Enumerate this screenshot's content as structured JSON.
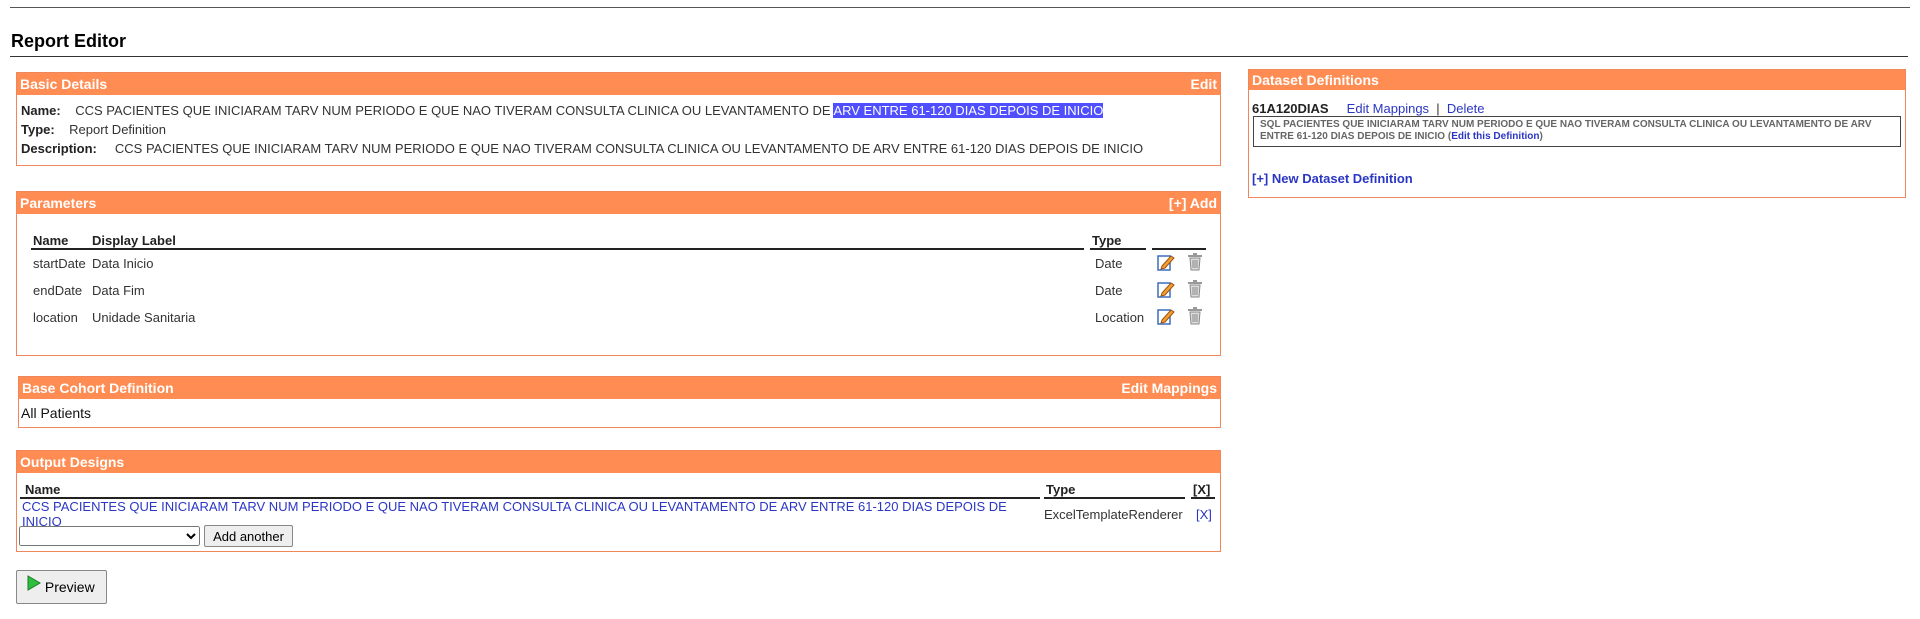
{
  "page": {
    "title": "Report Editor"
  },
  "basic": {
    "header": "Basic Details",
    "edit": "Edit",
    "name_label": "Name:",
    "name_pre": "CCS PACIENTES QUE INICIARAM TARV NUM PERIODO E QUE NAO TIVERAM CONSULTA CLINICA OU LEVANTAMENTO DE ",
    "name_sel": "ARV ENTRE 61-120 DIAS DEPOIS DE INICIO",
    "type_label": "Type:",
    "type_value": "Report Definition",
    "desc_label": "Description:",
    "desc_value": "CCS PACIENTES QUE INICIARAM TARV NUM PERIODO E QUE NAO TIVERAM CONSULTA CLINICA OU LEVANTAMENTO DE ARV ENTRE 61-120 DIAS DEPOIS DE INICIO"
  },
  "params": {
    "header": "Parameters",
    "add": "[+] Add",
    "columns": [
      "Name",
      "Display Label",
      "Type"
    ],
    "rows": [
      {
        "name": "startDate",
        "label": "Data Inicio",
        "type": "Date"
      },
      {
        "name": "endDate",
        "label": "Data Fim",
        "type": "Date"
      },
      {
        "name": "location",
        "label": "Unidade Sanitaria",
        "type": "Location"
      }
    ]
  },
  "cohort": {
    "header": "Base Cohort Definition",
    "edit": "Edit Mappings",
    "value": "All Patients"
  },
  "output": {
    "header": "Output Designs",
    "columns": [
      "Name",
      "Type",
      "[X]"
    ],
    "row": {
      "name": "CCS PACIENTES QUE INICIARAM TARV NUM PERIODO E QUE NAO TIVERAM CONSULTA CLINICA OU LEVANTAMENTO DE ARV ENTRE 61-120 DIAS DEPOIS DE INICIO",
      "type": "ExcelTemplateRenderer",
      "remove": "[X]"
    },
    "select_value": "",
    "add_another": "Add another"
  },
  "preview": "Preview",
  "dataset": {
    "header": "Dataset Definitions",
    "name": "61A120DIAS",
    "edit_mappings": "Edit Mappings",
    "separator": "|",
    "delete": "Delete",
    "sql": "SQL PACIENTES QUE INICIARAM TARV NUM PERIODO E QUE NAO TIVERAM CONSULTA CLINICA OU LEVANTAMENTO DE ARV ENTRE 61-120 DIAS DEPOIS DE INICIO",
    "paren_open": "(",
    "edit_def": "Edit this Definition",
    "paren_close": ")",
    "new_def": "[+] New Dataset Definition"
  },
  "colors": {
    "header_bg": "#ff8c52",
    "border": "#f0875a",
    "link": "#2a36c4",
    "selection": "#4f4fff"
  },
  "icons": {
    "edit": "edit-icon",
    "delete": "trash-icon",
    "preview": "play-icon"
  }
}
